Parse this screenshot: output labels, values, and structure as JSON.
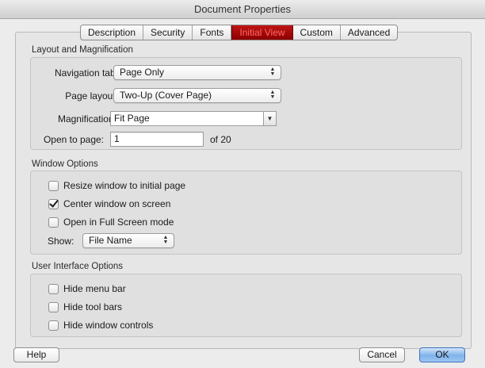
{
  "window": {
    "title": "Document Properties"
  },
  "tabs": [
    {
      "label": "Description"
    },
    {
      "label": "Security"
    },
    {
      "label": "Fonts"
    },
    {
      "label": "Initial View"
    },
    {
      "label": "Custom"
    },
    {
      "label": "Advanced"
    }
  ],
  "active_tab_color": "#a00000",
  "layout": {
    "section_title": "Layout and Magnification",
    "navigation_tab_label": "Navigation tab:",
    "navigation_tab_value": "Page Only",
    "page_layout_label": "Page layout:",
    "page_layout_value": "Two-Up (Cover Page)",
    "magnification_label": "Magnification:",
    "magnification_value": "Fit Page",
    "open_to_page_label": "Open to page:",
    "open_to_page_value": "1",
    "page_count_text": "of 20"
  },
  "window_options": {
    "section_title": "Window Options",
    "resize_label": "Resize window to initial page",
    "resize_checked": false,
    "center_label": "Center window on screen",
    "center_checked": true,
    "fullscreen_label": "Open in Full Screen mode",
    "fullscreen_checked": false,
    "show_label": "Show:",
    "show_value": "File Name"
  },
  "ui_options": {
    "section_title": "User Interface Options",
    "hide_menu_label": "Hide menu bar",
    "hide_menu_checked": false,
    "hide_toolbars_label": "Hide tool bars",
    "hide_toolbars_checked": false,
    "hide_controls_label": "Hide window controls",
    "hide_controls_checked": false
  },
  "buttons": {
    "help": "Help",
    "cancel": "Cancel",
    "ok": "OK"
  },
  "accent_color": "#7fb2ea"
}
